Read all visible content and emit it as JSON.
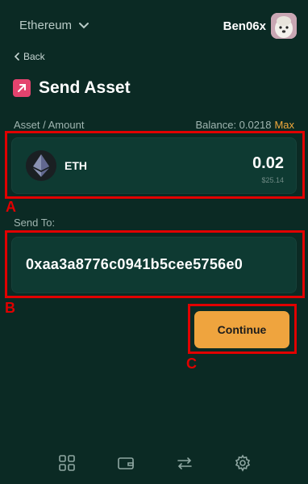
{
  "header": {
    "network": "Ethereum",
    "username": "Ben06x"
  },
  "nav": {
    "back_label": "Back"
  },
  "page": {
    "title": "Send Asset"
  },
  "asset": {
    "section_label": "Asset / Amount",
    "balance_text": "Balance: 0.0218",
    "max_label": "Max",
    "symbol": "ETH",
    "amount": "0.02",
    "usd_value": "$25.14"
  },
  "send_to": {
    "label": "Send To:",
    "address": "0xaa3a8776c0941b5cee5756e0"
  },
  "actions": {
    "continue_label": "Continue"
  },
  "annotations": {
    "a": "A",
    "b": "B",
    "c": "C"
  },
  "bottom_nav": [
    "grid-icon",
    "wallet-icon",
    "transfer-icon",
    "settings-icon"
  ],
  "colors": {
    "background": "#0b2a24",
    "card": "#0e3a32",
    "accent": "#efa43e",
    "annotation": "#e10000",
    "title_icon": "#e4436e"
  }
}
